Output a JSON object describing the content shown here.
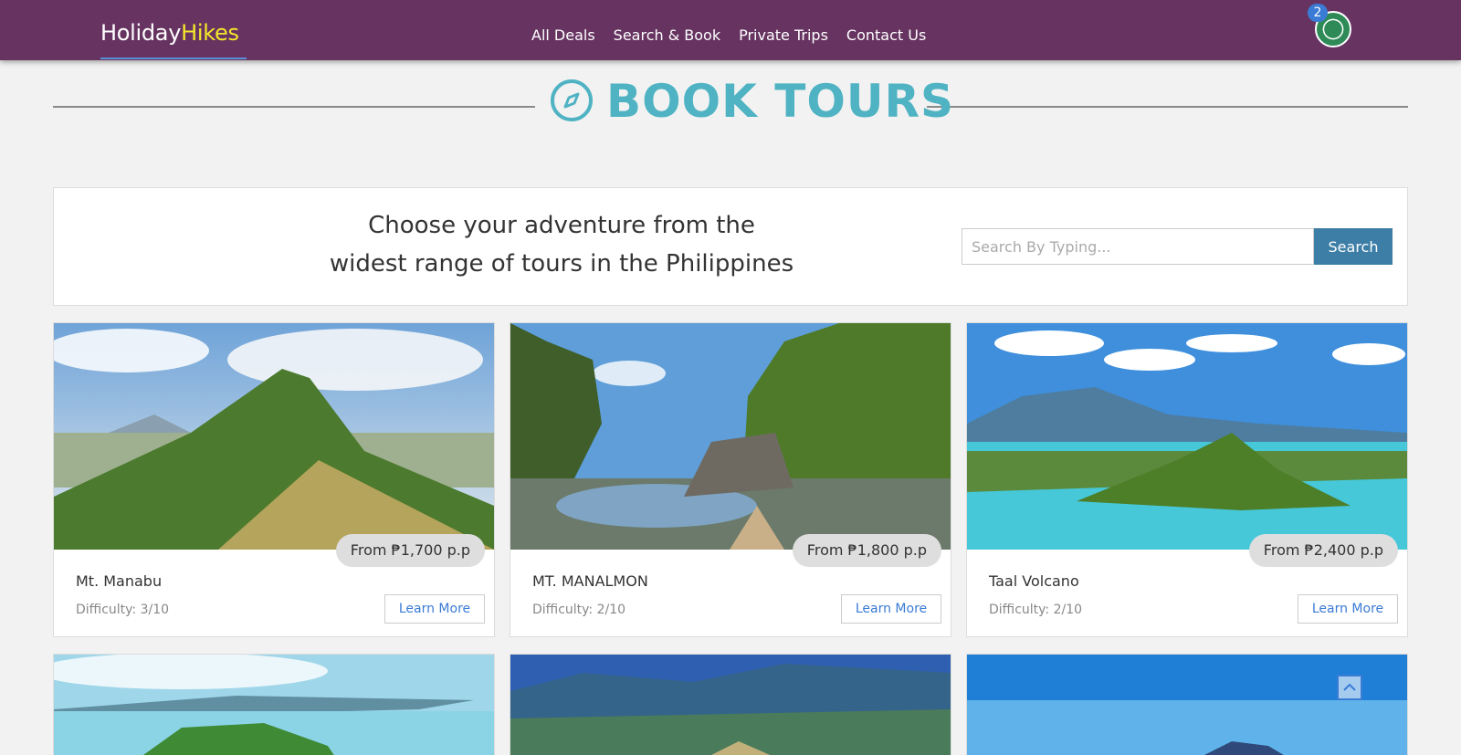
{
  "navbar": {
    "brand_part1": "Holiday",
    "brand_part2": "Hikes",
    "links": [
      "All Deals",
      "Search & Book",
      "Private Trips",
      "Contact Us"
    ],
    "notification_count": "2"
  },
  "header": {
    "title": "BOOK TOURS",
    "icon": "compass-icon"
  },
  "panel": {
    "tagline_line1": "Choose your adventure from the",
    "tagline_line2": "widest range of tours in the Philippines",
    "search_placeholder": "Search By Typing...",
    "search_button": "Search"
  },
  "tours": [
    {
      "name": "Mt. Manabu",
      "price": "From ₱1,700 p.p",
      "difficulty": "Difficulty: 3/10",
      "button": "Learn More"
    },
    {
      "name": "MT. MANALMON",
      "price": "From ₱1,800 p.p",
      "difficulty": "Difficulty: 2/10",
      "button": "Learn More"
    },
    {
      "name": "Taal Volcano",
      "price": "From ₱2,400 p.p",
      "difficulty": "Difficulty: 2/10",
      "button": "Learn More"
    }
  ],
  "colors": {
    "navbar": "#673462",
    "brand_accent": "#f2e82a",
    "title": "#4fb3c3",
    "search_button": "#3d7ea6",
    "link": "#3a7bd5"
  }
}
